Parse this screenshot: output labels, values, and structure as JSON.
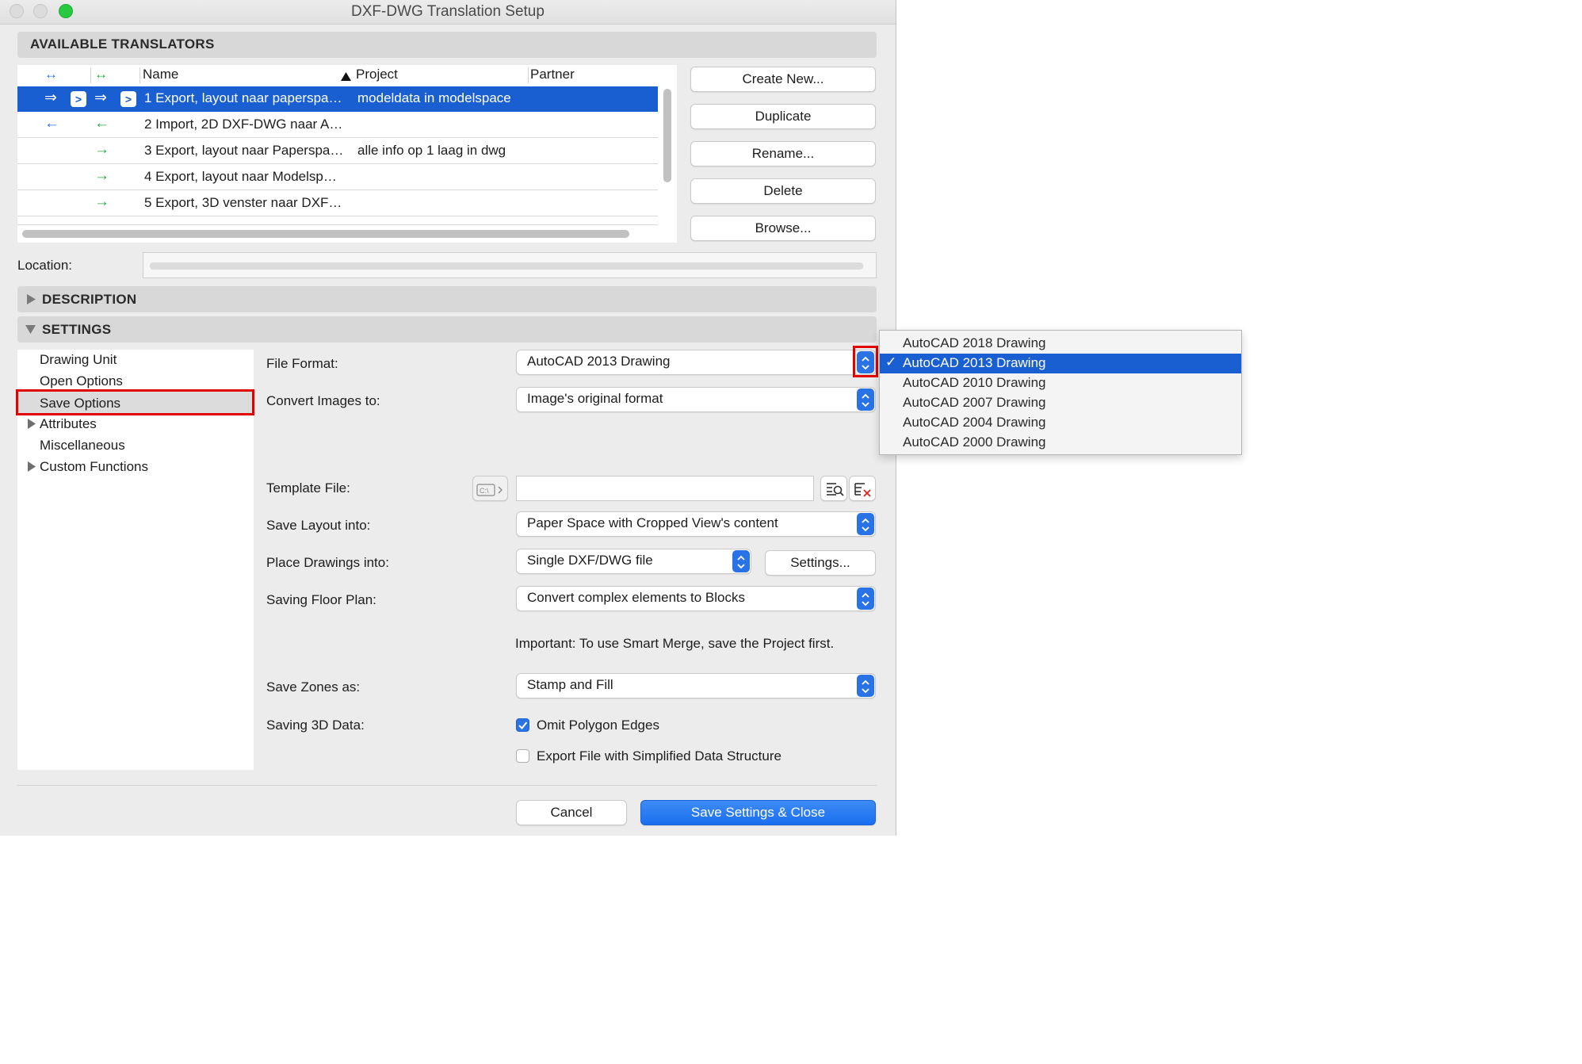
{
  "window": {
    "title": "DXF-DWG Translation Setup",
    "colors": {
      "accent": "#1a5fd2",
      "close": "#ff5f57",
      "green": "#28c840",
      "arrow_blue": "#2a73e6",
      "arrow_green": "#28a745",
      "highlight": "#e00000"
    }
  },
  "translators": {
    "header": "AVAILABLE TRANSLATORS",
    "columns": {
      "name": "Name",
      "project": "Project",
      "partner": "Partner"
    },
    "rows": [
      {
        "name": "1 Export, layout naar paperspa…",
        "project": "modeldata in modelspace"
      },
      {
        "name": "2 Import, 2D DXF-DWG naar A…",
        "project": ""
      },
      {
        "name": "3 Export, layout naar Paperspa…",
        "project": "alle info op 1 laag in dwg"
      },
      {
        "name": "4 Export, layout naar Modelsp…",
        "project": ""
      },
      {
        "name": "5 Export, 3D venster naar DXF…",
        "project": ""
      }
    ],
    "buttons": {
      "create_new": "Create New...",
      "duplicate": "Duplicate",
      "rename": "Rename...",
      "delete": "Delete",
      "browse": "Browse..."
    }
  },
  "location": {
    "label": "Location:"
  },
  "description": {
    "header": "DESCRIPTION"
  },
  "settings": {
    "header": "SETTINGS",
    "tree": {
      "drawing_unit": "Drawing Unit",
      "open_options": "Open Options",
      "save_options": "Save Options",
      "attributes": "Attributes",
      "miscellaneous": "Miscellaneous",
      "custom_functions": "Custom Functions"
    },
    "file_format": {
      "label": "File Format:",
      "value": "AutoCAD 2013 Drawing"
    },
    "convert_images": {
      "label": "Convert Images to:",
      "value": "Image's original format"
    },
    "template_file": {
      "label": "Template File:",
      "value": ""
    },
    "save_layout": {
      "label": "Save Layout into:",
      "value": "Paper Space with Cropped View's content"
    },
    "place_drawings": {
      "label": "Place Drawings into:",
      "value": "Single DXF/DWG file",
      "settings_button": "Settings..."
    },
    "saving_floor_plan": {
      "label": "Saving Floor Plan:",
      "value": "Convert complex elements to Blocks"
    },
    "important_note": "Important: To use Smart Merge, save the Project first.",
    "save_zones": {
      "label": "Save Zones as:",
      "value": "Stamp and Fill"
    },
    "saving_3d": {
      "label": "Saving 3D Data:",
      "omit_edges": "Omit Polygon Edges",
      "omit_edges_checked": true,
      "simplified": "Export File with Simplified Data Structure",
      "simplified_checked": false
    }
  },
  "footer": {
    "cancel": "Cancel",
    "save_close": "Save Settings & Close"
  },
  "file_format_menu": {
    "options": [
      "AutoCAD 2018 Drawing",
      "AutoCAD 2013 Drawing",
      "AutoCAD 2010 Drawing",
      "AutoCAD 2007 Drawing",
      "AutoCAD 2004 Drawing",
      "AutoCAD 2000 Drawing"
    ],
    "selected": "AutoCAD 2013 Drawing"
  }
}
